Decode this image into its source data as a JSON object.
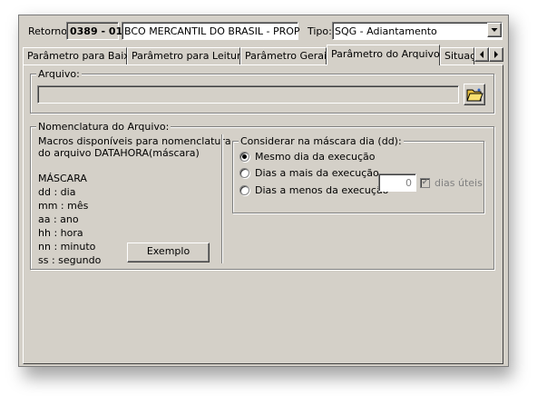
{
  "header": {
    "retorno_label": "Retorno:",
    "retorno_code": "0389 - 01",
    "bank_name": "BCO MERCANTIL DO BRASIL - PROP",
    "tipo_label": "Tipo:",
    "tipo_value": "SQG - Adiantamento"
  },
  "tabs": [
    {
      "label": "Parâmetro para Baixa"
    },
    {
      "label": "Parâmetro para Leitura"
    },
    {
      "label": "Parâmetro Gerais"
    },
    {
      "label": "Parâmetro do Arquivo"
    },
    {
      "label": "Situaçã"
    }
  ],
  "active_tab": "Parâmetro do Arquivo",
  "arquivo": {
    "group_label": "Arquivo:",
    "path_value": ""
  },
  "nomenclatura": {
    "group_label": "Nomenclatura do Arquivo:",
    "macros_line1": "Macros disponíveis para nomenclatura",
    "macros_line2": "do arquivo DATAHORA(máscara)",
    "mascara_title": "MÁSCARA",
    "mascara_items": [
      "dd : dia",
      "mm : mês",
      "aa : ano",
      "hh : hora",
      "nn : minuto",
      "ss : segundo"
    ],
    "exemplo_button": "Exemplo"
  },
  "considerar": {
    "group_label": "Considerar na máscara dia (dd):",
    "options": [
      {
        "label": "Mesmo dia da execução",
        "selected": true
      },
      {
        "label": "Dias a mais da execução",
        "selected": false
      },
      {
        "label": "Dias a menos da execução",
        "selected": false
      }
    ],
    "days_value": "0",
    "dias_uteis_label": "dias úteis",
    "dias_uteis_checked": true
  }
}
